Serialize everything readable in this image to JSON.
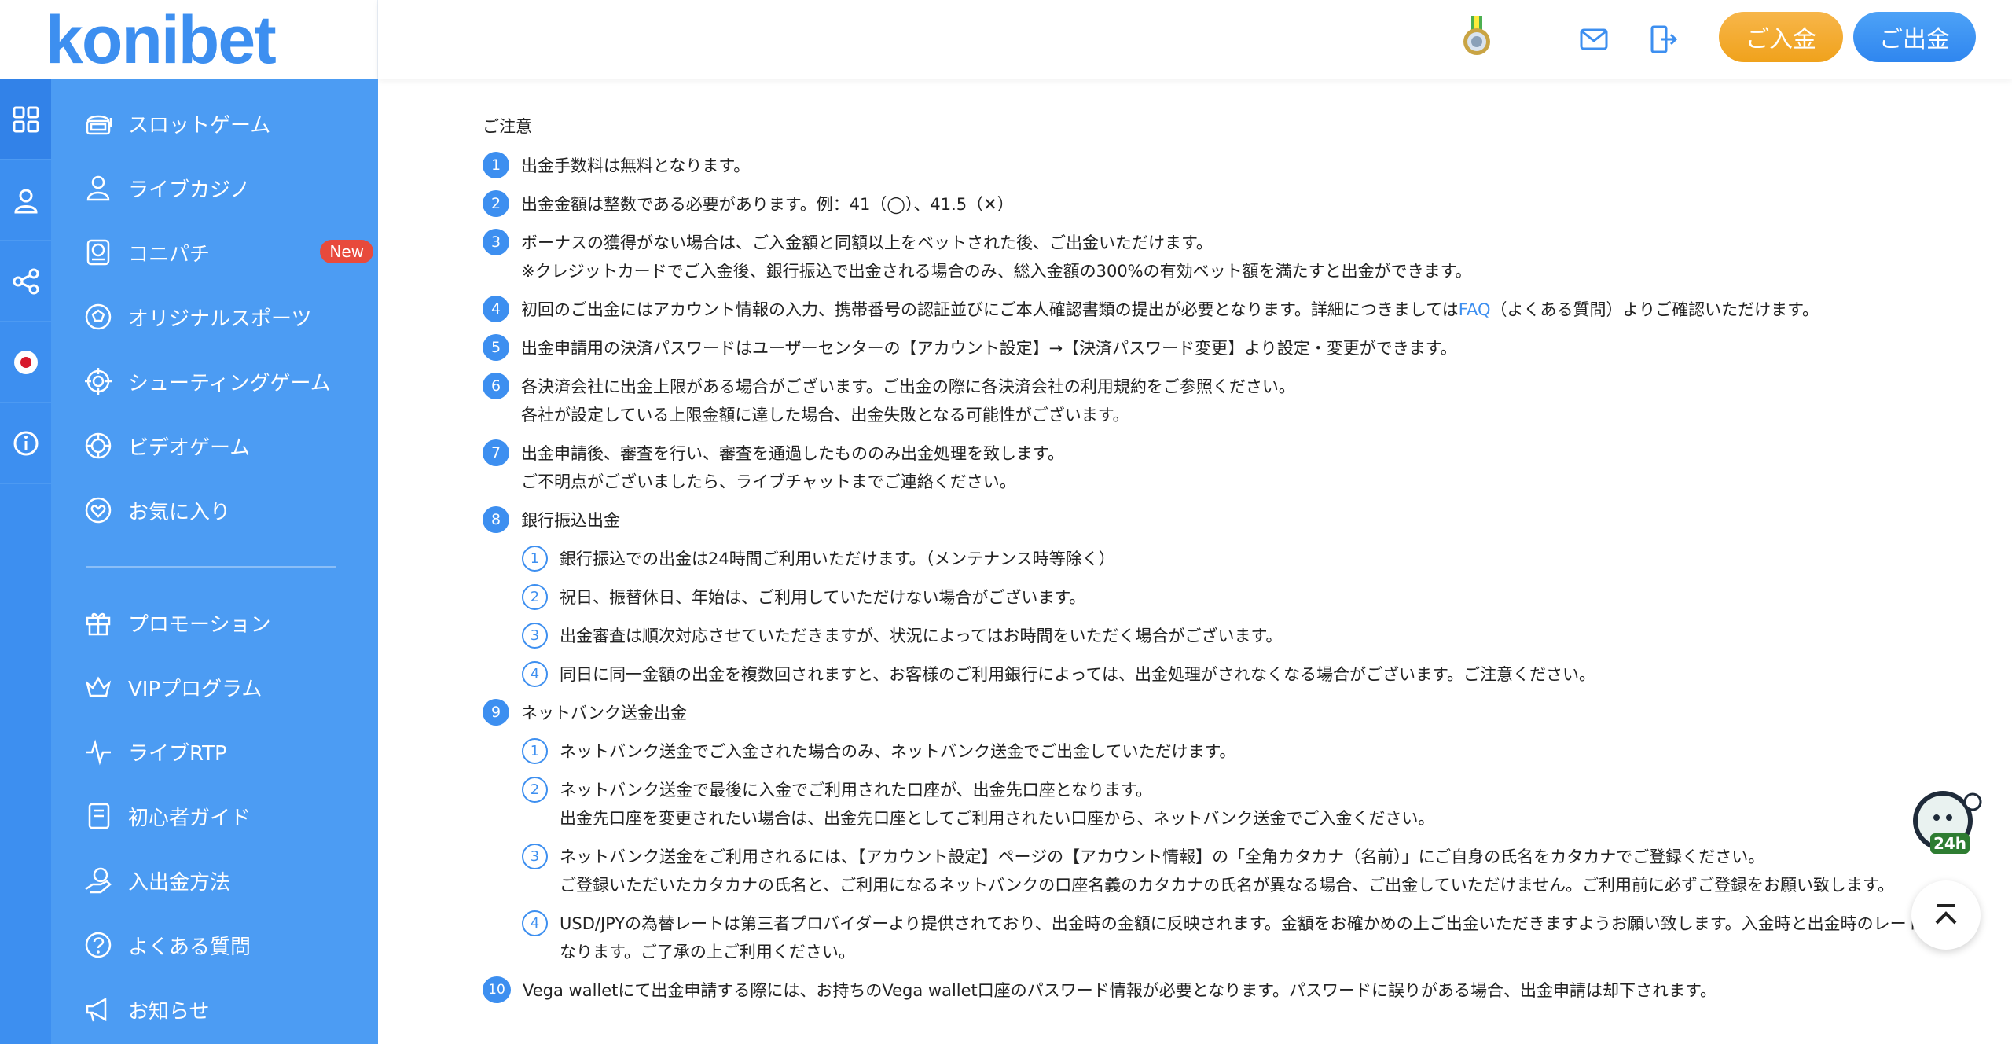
{
  "brand": {
    "logo_text": "konibet",
    "accent": "#3d8ff0",
    "orange": "#f0a21c"
  },
  "header": {
    "deposit_label": "ご入金",
    "withdraw_label": "ご出金",
    "icons": [
      "medal-icon",
      "mail-icon",
      "logout-icon"
    ]
  },
  "rail": {
    "icons": [
      "grid-icon",
      "user-icon",
      "share-icon",
      "japan-flag-icon",
      "info-icon"
    ]
  },
  "sidebar": {
    "items": [
      {
        "label": "スロットゲーム",
        "icon": "slot-machine-icon"
      },
      {
        "label": "ライブカジノ",
        "icon": "dealer-icon"
      },
      {
        "label": "コニパチ",
        "icon": "pachinko-icon",
        "badge": "New"
      },
      {
        "label": "オリジナルスポーツ",
        "icon": "soccer-ball-icon"
      },
      {
        "label": "シューティングゲーム",
        "icon": "target-icon"
      },
      {
        "label": "ビデオゲーム",
        "icon": "chip-icon"
      },
      {
        "label": "お気に入り",
        "icon": "heart-icon"
      },
      {
        "label": "プロモーション",
        "icon": "gift-icon"
      },
      {
        "label": "VIPプログラム",
        "icon": "vip-crown-icon"
      },
      {
        "label": "ライブRTP",
        "icon": "pulse-icon"
      },
      {
        "label": "初心者ガイド",
        "icon": "guide-book-icon"
      },
      {
        "label": "入出金方法",
        "icon": "coin-hand-icon"
      },
      {
        "label": "よくある質問",
        "icon": "question-icon"
      },
      {
        "label": "お知らせ",
        "icon": "megaphone-icon"
      }
    ]
  },
  "notice": {
    "title": "ご注意",
    "items": [
      {
        "n": "1",
        "lines": [
          "出金手数料は無料となります。"
        ]
      },
      {
        "n": "2",
        "lines": [
          "出金金額は整数である必要があります。例：41（◯）、41.5（✕）"
        ]
      },
      {
        "n": "3",
        "lines": [
          "ボーナスの獲得がない場合は、ご入金額と同額以上をベットされた後、ご出金いただけます。",
          "※クレジットカードでご入金後、銀行振込で出金される場合のみ、総入金額の300%の有効ベット額を満たすと出金ができます。"
        ]
      },
      {
        "n": "4",
        "before": "初回のご出金にはアカウント情報の入力、携帯番号の認証並びにご本人確認書類の提出が必要となります。詳細につきましては",
        "link": "FAQ",
        "after": "（よくある質問）よりご確認いただけます。"
      },
      {
        "n": "5",
        "lines": [
          "出金申請用の決済パスワードはユーザーセンターの【アカウント設定】→【決済パスワード変更】より設定・変更ができます。"
        ]
      },
      {
        "n": "6",
        "lines": [
          "各決済会社に出金上限がある場合がございます。ご出金の際に各決済会社の利用規約をご参照ください。",
          "各社が設定している上限金額に達した場合、出金失敗となる可能性がございます。"
        ]
      },
      {
        "n": "7",
        "lines": [
          "出金申請後、審査を行い、審査を通過したもののみ出金処理を致します。",
          "ご不明点がございましたら、ライブチャットまでご連絡ください。"
        ]
      },
      {
        "n": "8",
        "lines": [
          "銀行振込出金"
        ],
        "subs": [
          {
            "n": "1",
            "lines": [
              "銀行振込での出金は24時間ご利用いただけます。（メンテナンス時等除く）"
            ]
          },
          {
            "n": "2",
            "lines": [
              "祝日、振替休日、年始は、ご利用していただけない場合がございます。"
            ]
          },
          {
            "n": "3",
            "lines": [
              "出金審査は順次対応させていただきますが、状況によってはお時間をいただく場合がございます。"
            ]
          },
          {
            "n": "4",
            "lines": [
              "同日に同一金額の出金を複数回されますと、お客様のご利用銀行によっては、出金処理がされなくなる場合がございます。ご注意ください。"
            ]
          }
        ]
      },
      {
        "n": "9",
        "lines": [
          "ネットバンク送金出金"
        ],
        "subs": [
          {
            "n": "1",
            "lines": [
              "ネットバンク送金でご入金された場合のみ、ネットバンク送金でご出金していただけます。"
            ]
          },
          {
            "n": "2",
            "lines": [
              "ネットバンク送金で最後に入金でご利用された口座が、出金先口座となります。",
              "出金先口座を変更されたい場合は、出金先口座としてご利用されたい口座から、ネットバンク送金でご入金ください。"
            ]
          },
          {
            "n": "3",
            "lines": [
              "ネットバンク送金をご利用されるには、【アカウント設定】ページの【アカウント情報】の「全角カタカナ（名前）」にご自身の氏名をカタカナでご登録ください。",
              "ご登録いただいたカタカナの氏名と、ご利用になるネットバンクの口座名義のカタカナの氏名が異なる場合、ご出金していただけません。ご利用前に必ずご登録をお願い致します。"
            ]
          },
          {
            "n": "4",
            "lines": [
              "USD/JPYの為替レートは第三者プロバイダーより提供されており、出金時の金額に反映されます。金額をお確かめの上ご出金いただきますようお願い致します。入金時と出金時のレートは異なります。ご了承の上ご利用ください。"
            ]
          }
        ]
      },
      {
        "n": "10",
        "lines": [
          "Vega walletにて出金申請する際には、お持ちのVega wallet口座のパスワード情報が必要となります。パスワードに誤りがある場合、出金申請は却下されます。"
        ]
      }
    ]
  },
  "floating": {
    "support_label": "24h"
  }
}
